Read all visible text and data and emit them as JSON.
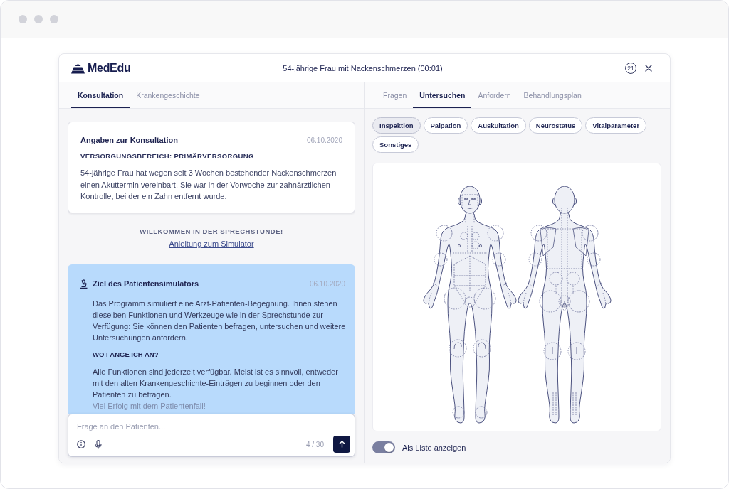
{
  "app": {
    "logo": "MedEdu",
    "title": "54-jährige Frau mit Nackenschmerzen (00:01)",
    "counter": "21"
  },
  "left_panel": {
    "tabs": [
      {
        "label": "Konsultation",
        "selected": true
      },
      {
        "label": "Krankengeschichte",
        "selected": false
      }
    ],
    "consultation_card": {
      "title": "Angaben zur Konsultation",
      "date": "06.10.2020",
      "section": "VERSORGUNGSBEREICH: PRIMÄRVERSORGUNG",
      "text": "54-jährige Frau hat wegen seit 3 Wochen bestehender Nackenschmerzen einen Akuttermin vereinbart. Sie war in der Vorwoche zur zahnärztlichen Kontrolle, bei der ein Zahn entfernt wurde."
    },
    "welcome": {
      "heading": "WILLKOMMEN IN DER SPRECHSTUNDE!",
      "link": "Anleitung zum Simulator"
    },
    "info_card": {
      "title": "Ziel des Patientensimulators",
      "date": "06.10.2020",
      "blocks": [
        {
          "kind": "paragraph",
          "text": "Das Programm simuliert eine Arzt-Patienten-Begegnung. Ihnen stehen dieselben Funktionen und Werkzeuge wie in der Sprechstunde zur Verfügung: Sie können den Patienten befragen, untersuchen und weitere Untersuchungen anfordern."
        },
        {
          "kind": "heading",
          "text": "WO FANGE ICH AN?"
        },
        {
          "kind": "paragraph",
          "text": "Alle Funktionen sind jederzeit verfügbar. Meist ist es sinnvoll, entweder mit den alten Krankengeschichte-Einträgen zu beginnen oder den Patienten zu befragen."
        },
        {
          "kind": "faded",
          "text": "Viel Erfolg mit dem Patientenfall!"
        }
      ]
    },
    "question_input": {
      "placeholder": "Frage an den Patienten...",
      "counter": "4 / 30"
    }
  },
  "right_panel": {
    "tabs": [
      {
        "label": "Fragen",
        "selected": false
      },
      {
        "label": "Untersuchen",
        "selected": true
      },
      {
        "label": "Anfordern",
        "selected": false
      },
      {
        "label": "Behandlungsplan",
        "selected": false
      }
    ],
    "exam_categories": [
      {
        "label": "Inspektion",
        "selected": true
      },
      {
        "label": "Palpation",
        "selected": false
      },
      {
        "label": "Auskultation",
        "selected": false
      },
      {
        "label": "Neurostatus",
        "selected": false
      },
      {
        "label": "Vitalparameter",
        "selected": false
      },
      {
        "label": "Sonstiges",
        "selected": false
      }
    ],
    "list_toggle": {
      "label": "Als Liste anzeigen",
      "on": true
    }
  }
}
